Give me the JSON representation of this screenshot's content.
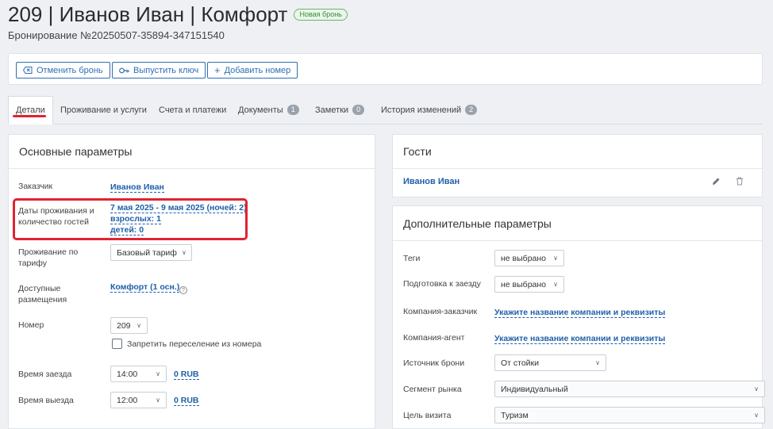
{
  "header": {
    "title": "209 | Иванов Иван | Комфорт",
    "badge": "Новая бронь",
    "subtitle": "Бронирование №20250507-35894-347151540"
  },
  "toolbar": {
    "cancel_label": "Отменить бронь",
    "key_label": "Выпустить ключ",
    "add_room_label": "Добавить номер"
  },
  "tabs": [
    {
      "label": "Детали"
    },
    {
      "label": "Проживание и услуги"
    },
    {
      "label": "Счета и платежи"
    },
    {
      "label": "Документы",
      "count": "1"
    },
    {
      "label": "Заметки",
      "count": "0"
    },
    {
      "label": "История изменений",
      "count": "2"
    }
  ],
  "main": {
    "title": "Основные параметры",
    "customer_label": "Заказчик",
    "customer_value": "Иванов Иван",
    "dates_label": "Даты проживания и количество гостей",
    "dates_value": "7 мая 2025 - 9 мая 2025 (ночей: 2)",
    "adults_value": "взрослых: 1",
    "children_value": "детей: 0",
    "tariff_label": "Проживание по тарифу",
    "tariff_value": "Базовый тариф",
    "placement_label": "Доступные размещения",
    "placement_value": "Комфорт (1 осн.)",
    "room_label": "Номер",
    "room_value": "209",
    "no_move_label": "Запретить переселение из номера",
    "checkin_label": "Время заезда",
    "checkin_value": "14:00",
    "checkin_price": "0 RUB",
    "checkout_label": "Время выезда",
    "checkout_value": "12:00",
    "checkout_price": "0 RUB"
  },
  "guests": {
    "title": "Гости",
    "guest_name": "Иванов Иван"
  },
  "extra": {
    "title": "Дополнительные параметры",
    "tags_label": "Теги",
    "tags_value": "не выбрано",
    "prep_label": "Подготовка к заезду",
    "prep_value": "не выбрано",
    "customer_company_label": "Компания-заказчик",
    "customer_company_value": "Укажите название компании и реквизиты",
    "agent_company_label": "Компания-агент",
    "agent_company_value": "Укажите название компании и реквизиты",
    "source_label": "Источник брони",
    "source_value": "От стойки",
    "segment_label": "Сегмент рынка",
    "segment_value": "Индивидуальный",
    "purpose_label": "Цель визита",
    "purpose_value": "Туризм"
  },
  "colors": {
    "accent": "#1f5fa8",
    "highlight": "#e0232f",
    "badge": "#3a8a3a"
  }
}
